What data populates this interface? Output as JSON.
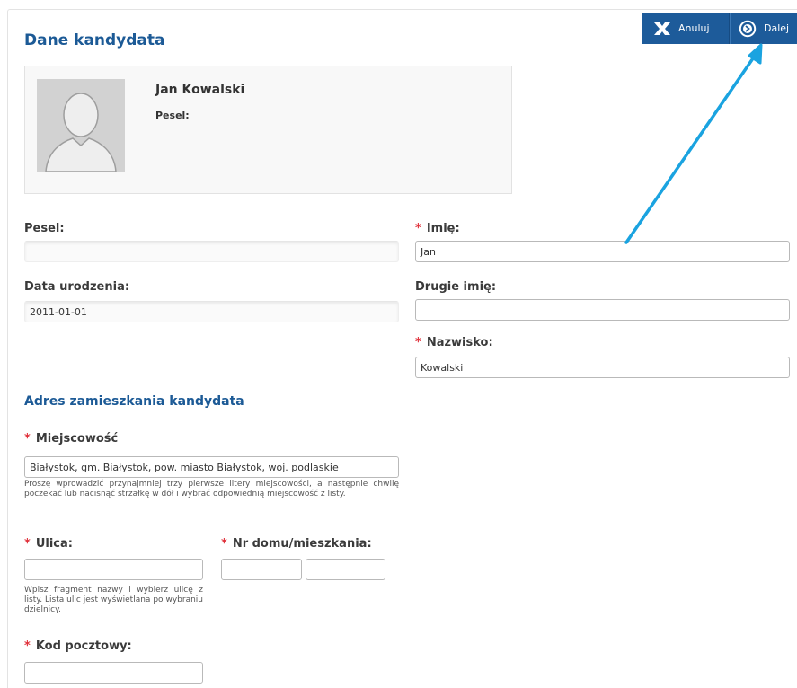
{
  "toolbar": {
    "cancel_label": "Anuluj",
    "next_label": "Dalej"
  },
  "candidate": {
    "section_title": "Dane kandydata",
    "name": "Jan Kowalski",
    "pesel_label": "Pesel:"
  },
  "form": {
    "pesel": {
      "label": "Pesel:",
      "value": ""
    },
    "birth_date": {
      "label": "Data urodzenia:",
      "value": "2011-01-01"
    },
    "first_name": {
      "required_mark": "*",
      "label": "Imię:",
      "value": "Jan"
    },
    "second_name": {
      "label": "Drugie imię:",
      "value": ""
    },
    "last_name": {
      "required_mark": "*",
      "label": "Nazwisko:",
      "value": "Kowalski"
    }
  },
  "address": {
    "section_title": "Adres zamieszkania kandydata",
    "city": {
      "required_mark": "*",
      "label": "Miejscowość",
      "value": "Białystok, gm. Białystok, pow. miasto Białystok, woj. podlaskie",
      "help": "Proszę wprowadzić przynajmniej trzy pierwsze litery miejscowości, a następnie chwilę poczekać lub nacisnąć strzałkę w dół i wybrać odpowiednią miejscowość z listy."
    },
    "street": {
      "required_mark": "*",
      "label": "Ulica:",
      "value": "",
      "help": "Wpisz fragment nazwy i wybierz ulicę z listy. Lista ulic jest wyświetlana po wybraniu dzielnicy."
    },
    "house_number": {
      "required_mark": "*",
      "label": "Nr domu/mieszkania:",
      "house_value": "",
      "flat_value": ""
    },
    "postal_code": {
      "required_mark": "*",
      "label": "Kod pocztowy:",
      "value": ""
    }
  },
  "colors": {
    "accent": "#1d5b9a",
    "heading": "#1c5a96",
    "required": "#e0303a",
    "annotation_arrow": "#1aa3e0"
  },
  "icons": {
    "cancel": "close-icon",
    "next": "arrow-circle-right-icon",
    "avatar": "person-silhouette-icon"
  }
}
